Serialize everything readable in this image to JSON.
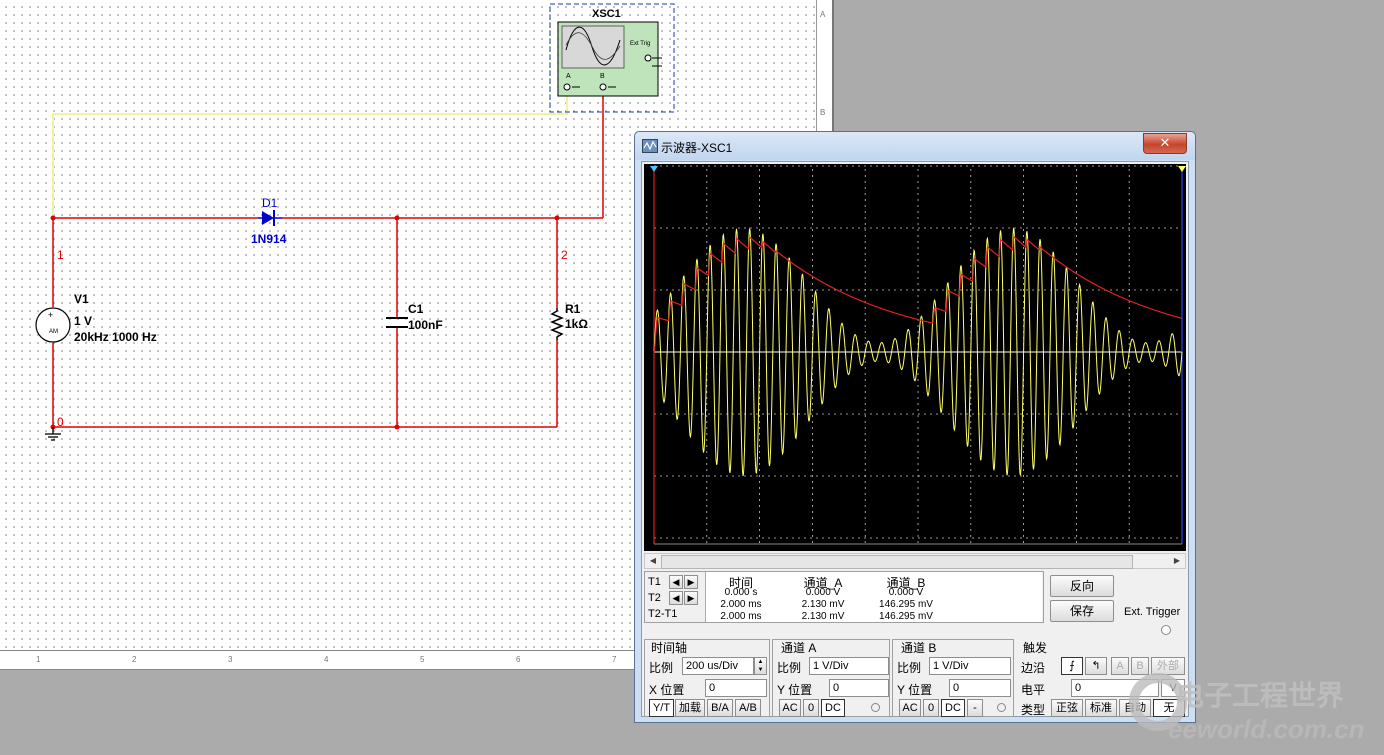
{
  "circuit": {
    "scope_ref": "XSC1",
    "scope_ext_trig": "Ext Trig",
    "scope_ch_a": "A",
    "scope_ch_b": "B",
    "diode_ref": "D1",
    "diode_model": "1N914",
    "source_ref": "V1",
    "source_amp": "1 V",
    "source_freq": "20kHz 1000 Hz",
    "source_symbol": "AM",
    "cap_ref": "C1",
    "cap_value": "100nF",
    "res_ref": "R1",
    "res_value": "1kΩ",
    "node_1": "1",
    "node_2": "2",
    "node_0": "0",
    "colors": {
      "wire_red": "#e00000",
      "wire_yellow": "#f2f2a0",
      "part_blue": "#0000cc"
    }
  },
  "rulers": {
    "bottom": [
      "1",
      "2",
      "3",
      "4",
      "5",
      "6",
      "7"
    ],
    "right": [
      "A",
      "B"
    ]
  },
  "oscilloscope": {
    "title": "示波器-XSC1",
    "close": "✕",
    "readout": {
      "headers": [
        "时间",
        "通道_A",
        "通道_B"
      ],
      "rows": [
        {
          "label": "T1",
          "time": "0.000 s",
          "a": "0.000 V",
          "b": "0.000 V"
        },
        {
          "label": "T2",
          "time": "2.000 ms",
          "a": "2.130 mV",
          "b": "146.295 mV"
        },
        {
          "label": "T2-T1",
          "time": "2.000 ms",
          "a": "2.130 mV",
          "b": "146.295 mV"
        }
      ]
    },
    "buttons": {
      "reverse": "反向",
      "save": "保存",
      "ext_trigger": "Ext. Trigger"
    },
    "timebase": {
      "title": "时间轴",
      "scale_label": "比例",
      "scale": "200 us/Div",
      "xpos_label": "X 位置",
      "xpos": "0",
      "modes": [
        "Y/T",
        "加载",
        "B/A",
        "A/B"
      ]
    },
    "channel_a": {
      "title": "通道 A",
      "scale_label": "比例",
      "scale": "1  V/Div",
      "ypos_label": "Y 位置",
      "ypos": "0",
      "coupling": [
        "AC",
        "0",
        "DC"
      ]
    },
    "channel_b": {
      "title": "通道 B",
      "scale_label": "比例",
      "scale": "1  V/Div",
      "ypos_label": "Y 位置",
      "ypos": "0",
      "coupling": [
        "AC",
        "0",
        "DC",
        "-"
      ]
    },
    "trigger": {
      "title": "触发",
      "edge_label": "边沿",
      "level_label": "电平",
      "level": "0",
      "level_unit": "V",
      "type_label": "类型",
      "sources": [
        "A",
        "B",
        "外部"
      ],
      "types": [
        "正弦",
        "标准",
        "自动",
        "无"
      ],
      "edge_rise": "⨍",
      "edge_fall": "↰"
    },
    "trace_colors": {
      "channel_a": "#ffff66",
      "channel_b": "#e02020",
      "grid": "#c8c8c8"
    }
  },
  "watermark": {
    "text": "电子工程世界",
    "site": "eeworld.com.cn"
  }
}
